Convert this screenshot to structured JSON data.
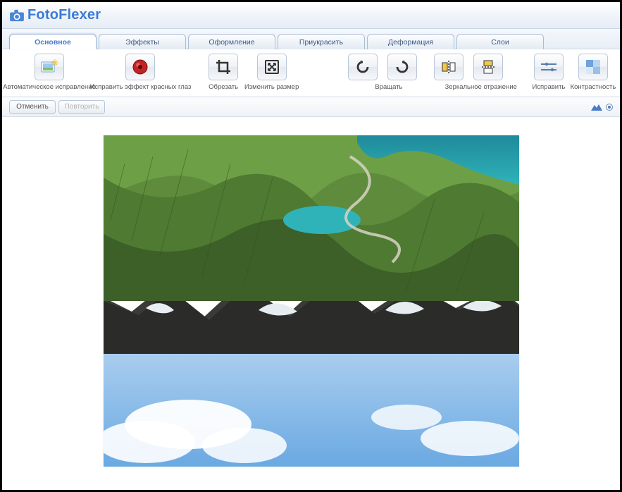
{
  "app": {
    "name": "FotoFlexer"
  },
  "tabs": [
    {
      "label": "Основное",
      "active": true
    },
    {
      "label": "Эффекты",
      "active": false
    },
    {
      "label": "Оформление",
      "active": false
    },
    {
      "label": "Приукрасить",
      "active": false
    },
    {
      "label": "Деформация",
      "active": false
    },
    {
      "label": "Слои",
      "active": false
    }
  ],
  "tools": {
    "autofix": "Автоматическое исправление",
    "redeye": "Исправить эффект красных глаз",
    "crop": "Обрезать",
    "resize": "Изменить размер",
    "rotate": "Вращать",
    "mirror": "Зеркальное отражение",
    "straighten": "Исправить",
    "contrast": "Контрастность"
  },
  "actions": {
    "undo": "Отменить",
    "redo": "Повторить"
  }
}
